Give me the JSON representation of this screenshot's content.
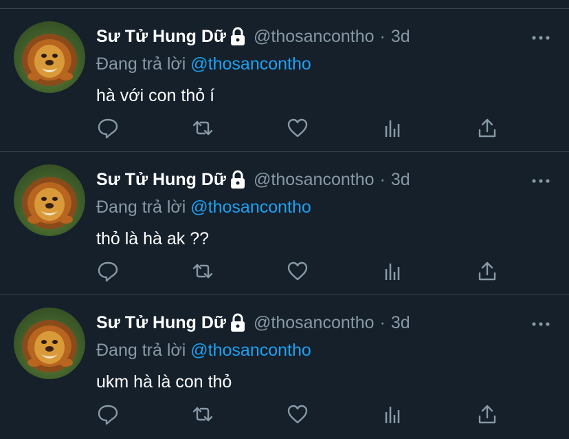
{
  "tweets": [
    {
      "name": "Sư Tử Hung Dữ",
      "handle": "@thosancontho",
      "separator": "·",
      "time": "3d",
      "replying_prefix": "Đang trả lời",
      "replying_to": "@thosancontho",
      "text": "hà với con thỏ í"
    },
    {
      "name": "Sư Tử Hung Dữ",
      "handle": "@thosancontho",
      "separator": "·",
      "time": "3d",
      "replying_prefix": "Đang trả lời",
      "replying_to": "@thosancontho",
      "text": "thỏ là hà ak ??"
    },
    {
      "name": "Sư Tử Hung Dữ",
      "handle": "@thosancontho",
      "separator": "·",
      "time": "3d",
      "replying_prefix": "Đang trả lời",
      "replying_to": "@thosancontho",
      "text": "ukm hà là con thỏ"
    }
  ],
  "icons": {
    "lock": "lock-icon",
    "more": "more-icon",
    "reply": "reply-icon",
    "retweet": "retweet-icon",
    "like": "heart-icon",
    "analytics": "analytics-icon",
    "share": "share-icon"
  },
  "colors": {
    "background": "#15202b",
    "divider": "#38444d",
    "primary_text": "#ffffff",
    "secondary_text": "#8899a6",
    "accent": "#1da1f2"
  }
}
